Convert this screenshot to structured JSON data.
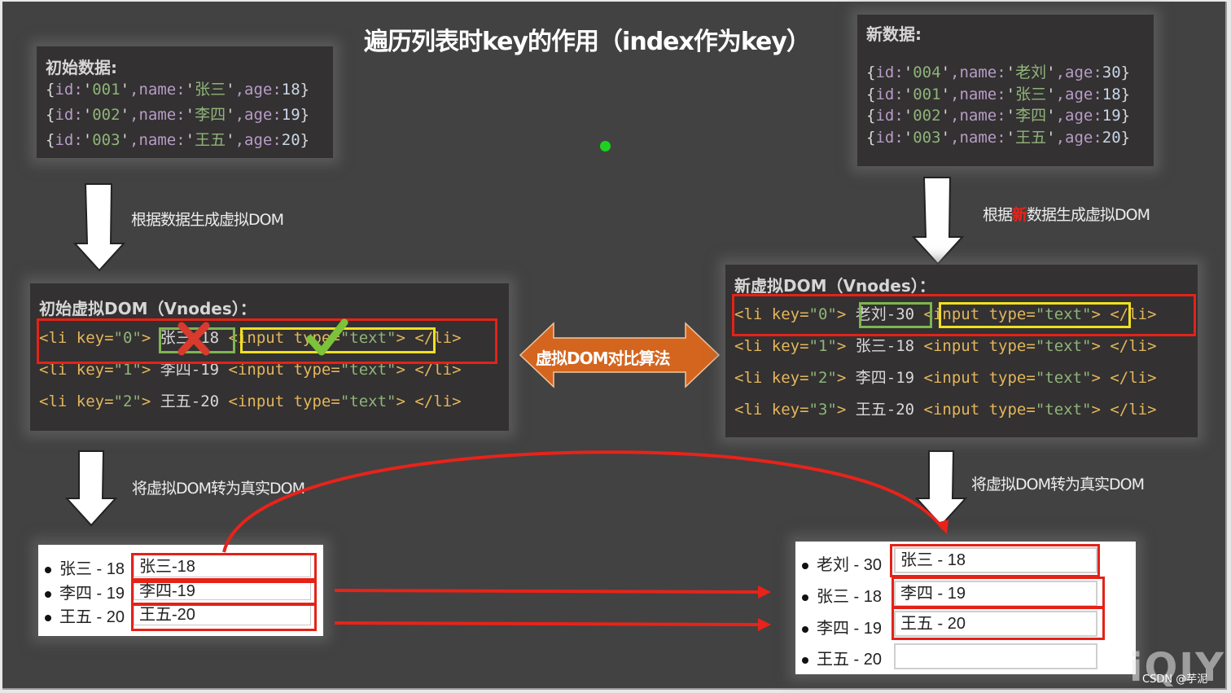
{
  "title": "遍历列表时key的作用（index作为key）",
  "initial_data": {
    "heading": "初始数据:",
    "rows": [
      {
        "id": "001",
        "name": "张三",
        "age": "18"
      },
      {
        "id": "002",
        "name": "李四",
        "age": "19"
      },
      {
        "id": "003",
        "name": "王五",
        "age": "20"
      }
    ]
  },
  "new_data": {
    "heading": "新数据:",
    "rows": [
      {
        "id": "004",
        "name": "老刘",
        "age": "30"
      },
      {
        "id": "001",
        "name": "张三",
        "age": "18"
      },
      {
        "id": "002",
        "name": "李四",
        "age": "19"
      },
      {
        "id": "003",
        "name": "王五",
        "age": "20"
      }
    ]
  },
  "code_tokens": {
    "open_brace": "{",
    "close_brace": "}",
    "id_key": "id:",
    "name_key": ",name:",
    "age_key": ",age:",
    "quote": "'",
    "li_open": "<li key=",
    "li_close_bracket": ">",
    "input": "<input type=",
    "text_value": "\"text\"",
    "input_close": ">",
    "li_end": "</li>"
  },
  "labels": {
    "gen_vdom": "根据数据生成虚拟DOM",
    "gen_new_vdom_prefix": "根据",
    "gen_new_vdom_highlight": "新",
    "gen_new_vdom_suffix": "数据生成虚拟DOM",
    "to_real_dom_left": "将虚拟DOM转为真实DOM",
    "to_real_dom_right": "将虚拟DOM转为真实DOM",
    "diff_algorithm": "虚拟DOM对比算法"
  },
  "initial_vdom": {
    "heading": "初始虚拟DOM（Vnodes）：",
    "rows": [
      {
        "key": "\"0\"",
        "text": "张三-18"
      },
      {
        "key": "\"1\"",
        "text": "李四-19"
      },
      {
        "key": "\"2\"",
        "text": "王五-20"
      }
    ]
  },
  "new_vdom": {
    "heading": "新虚拟DOM（Vnodes）：",
    "rows": [
      {
        "key": "\"0\"",
        "text": "老刘-30"
      },
      {
        "key": "\"1\"",
        "text": "张三-18"
      },
      {
        "key": "\"2\"",
        "text": "李四-19"
      },
      {
        "key": "\"3\"",
        "text": "王五-20"
      }
    ]
  },
  "initial_real_dom": [
    {
      "label": "张三 - 18",
      "input_value": "张三-18"
    },
    {
      "label": "李四 - 19",
      "input_value": "李四-19"
    },
    {
      "label": "王五 - 20",
      "input_value": "王五-20"
    }
  ],
  "new_real_dom": [
    {
      "label": "老刘 - 30",
      "input_value": "张三 - 18"
    },
    {
      "label": "张三 - 18",
      "input_value": "李四 - 19"
    },
    {
      "label": "李四 - 19",
      "input_value": "王五 - 20"
    },
    {
      "label": "王五 - 20",
      "input_value": ""
    }
  ],
  "watermark": {
    "logo": "iQIY",
    "credit": "CSDN @芋泥"
  },
  "colors": {
    "background": "#424242",
    "panel": "#333131",
    "highlight_red": "#e52218",
    "highlight_green": "#7fb551",
    "highlight_yellow": "#f0e020",
    "diff_arrow": "#d4651e",
    "laser_dot": "#1ed11e"
  }
}
